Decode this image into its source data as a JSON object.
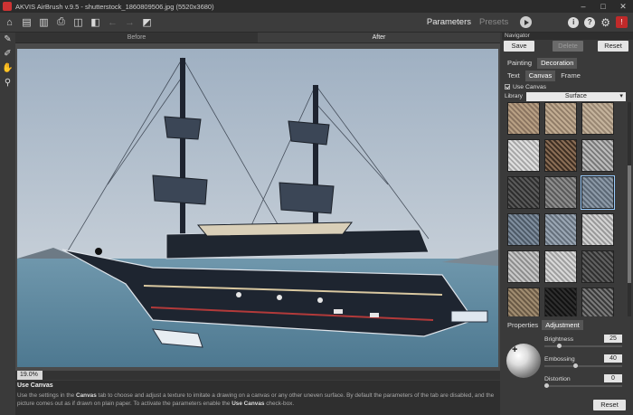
{
  "window": {
    "title": "AKVIS AirBrush v.9.5 - shutterstock_1860809506.jpg (5520x3680)"
  },
  "toolbar": {
    "parameters_label": "Parameters",
    "presets_label": "Presets"
  },
  "view_tabs": {
    "before": "Before",
    "after": "After"
  },
  "zoom": {
    "value": "19.0%"
  },
  "hint": {
    "title": "Use Canvas",
    "text_1": "Use the settings in the ",
    "canvas_word": "Canvas",
    "text_2": " tab to choose and adjust a texture to imitate a drawing on a canvas or any other uneven surface. By default the parameters of the tab are disabled, and the picture comes out as if drawn on plain paper. To activate the parameters enable the ",
    "use_canvas": "Use Canvas",
    "text_3": " check-box."
  },
  "panel": {
    "navigator_label": "Navigator",
    "save_label": "Save",
    "delete_label": "Delete",
    "reset_label": "Reset",
    "tabs": {
      "painting": "Painting",
      "decoration": "Decoration"
    },
    "subtabs": {
      "text": "Text",
      "canvas": "Canvas",
      "frame": "Frame"
    },
    "use_canvas_label": "Use Canvas",
    "library_label": "Library",
    "library_value": "Surface",
    "props_tabs": {
      "properties": "Properties",
      "adjustment": "Adjustment"
    },
    "params": {
      "brightness": {
        "label": "Brightness",
        "value": "25"
      },
      "embossing": {
        "label": "Embossing",
        "value": "40"
      },
      "distortion": {
        "label": "Distortion",
        "value": "0"
      }
    },
    "reset_bottom_label": "Reset"
  },
  "textures": [
    {
      "c1": "#b8a084",
      "c2": "#8a7460"
    },
    {
      "c1": "#c2ad93",
      "c2": "#927e69"
    },
    {
      "c1": "#c4b39c",
      "c2": "#9a8874"
    },
    {
      "c1": "#e0e0e0",
      "c2": "#a8a8a8"
    },
    {
      "c1": "#8a6d55",
      "c2": "#3e2f23"
    },
    {
      "c1": "#bdbdbd",
      "c2": "#7a7a7a"
    },
    {
      "c1": "#5a5a5a",
      "c2": "#2e2e2e"
    },
    {
      "c1": "#8e8e8e",
      "c2": "#5a5a5a"
    },
    {
      "c1": "#8d9aa8",
      "c2": "#5c6875"
    },
    {
      "c1": "#7f8e9e",
      "c2": "#4e5a67"
    },
    {
      "c1": "#9aa6b3",
      "c2": "#66717d"
    },
    {
      "c1": "#d4d4d4",
      "c2": "#9a9a9a"
    },
    {
      "c1": "#c9c9c9",
      "c2": "#8e8e8e"
    },
    {
      "c1": "#d8d8d8",
      "c2": "#a0a0a0"
    },
    {
      "c1": "#606060",
      "c2": "#303030"
    },
    {
      "c1": "#a08c70",
      "c2": "#6a5a46"
    },
    {
      "c1": "#2e2e2e",
      "c2": "#121212"
    },
    {
      "c1": "#7a7a7a",
      "c2": "#3a3a3a"
    },
    {
      "c1": "#b09880",
      "c2": "#6a5642"
    },
    {
      "c1": "#5c4636",
      "c2": "#2e2018"
    },
    {
      "c1": "#8e6a6a",
      "c2": "#4e3434"
    }
  ]
}
